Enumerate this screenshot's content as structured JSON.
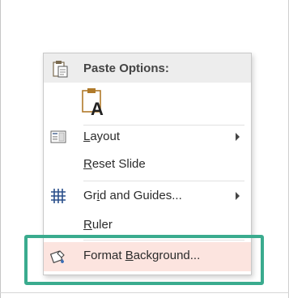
{
  "menu": {
    "header": {
      "label": "Paste Options:",
      "icon": "clipboard-icon"
    },
    "paste_options": [
      {
        "icon": "keep-text-only-icon",
        "glyph": "A"
      }
    ],
    "items": [
      {
        "pre": "",
        "ul": "L",
        "post": "ayout",
        "icon": "layout-icon",
        "submenu": true
      },
      {
        "pre": "",
        "ul": "R",
        "post": "eset Slide",
        "icon": "",
        "submenu": false
      },
      {
        "pre": "Gr",
        "ul": "i",
        "post": "d and Guides...",
        "icon": "grid-icon",
        "submenu": true
      },
      {
        "pre": "",
        "ul": "R",
        "post": "uler",
        "icon": "",
        "submenu": false
      },
      {
        "pre": "Format ",
        "ul": "B",
        "post": "ackground...",
        "icon": "format-background-icon",
        "submenu": false,
        "hovered": true
      }
    ]
  },
  "colors": {
    "highlight_border": "#3aab8e",
    "hover_background": "#fce4df",
    "header_background": "#ededed"
  }
}
